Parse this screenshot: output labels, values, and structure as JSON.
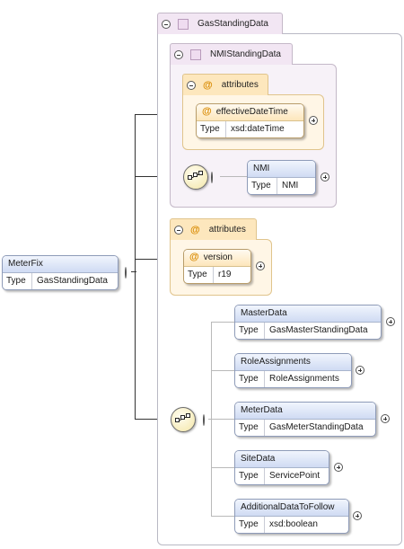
{
  "root": {
    "name": "MeterFix",
    "type_key": "Type",
    "type_value": "GasStandingData"
  },
  "gas_standing_data": {
    "label": "GasStandingData"
  },
  "nmi_standing_data": {
    "label": "NMIStandingData"
  },
  "nmi_attributes": {
    "label": "attributes"
  },
  "effective_date_time": {
    "name": "effectiveDateTime",
    "type_key": "Type",
    "type_value": "xsd:dateTime"
  },
  "nmi": {
    "name": "NMI",
    "type_key": "Type",
    "type_value": "NMI"
  },
  "gas_attributes": {
    "label": "attributes"
  },
  "version": {
    "name": "version",
    "type_key": "Type",
    "type_value": "r19"
  },
  "children": [
    {
      "name": "MasterData",
      "type_key": "Type",
      "type_value": "GasMasterStandingData"
    },
    {
      "name": "RoleAssignments",
      "type_key": "Type",
      "type_value": "RoleAssignments"
    },
    {
      "name": "MeterData",
      "type_key": "Type",
      "type_value": "GasMeterStandingData"
    },
    {
      "name": "SiteData",
      "type_key": "Type",
      "type_value": "ServicePoint"
    },
    {
      "name": "AdditionalDataToFollow",
      "type_key": "Type",
      "type_value": "xsd:boolean"
    }
  ],
  "symbols": {
    "attribute": "@",
    "sequence_icon": "sequence-icon",
    "expand_icon": "plus-icon",
    "collapse_icon": "minus-icon"
  },
  "colors": {
    "element_header": "#cfdbf3",
    "attribute_header": "#fde6bb",
    "complex_type_tab": "#f2e6f3",
    "sequence": "#f3e6a8"
  }
}
